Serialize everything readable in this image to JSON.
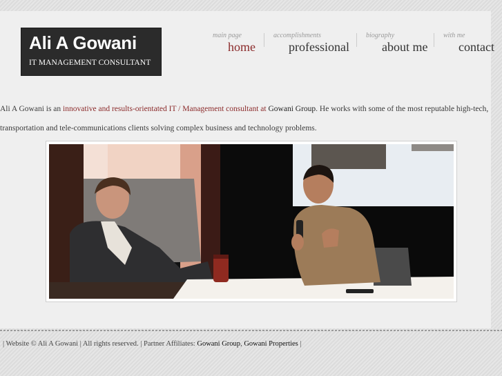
{
  "brand": {
    "name": "Ali A Gowani",
    "tagline": "IT MANAGEMENT CONSULTANT"
  },
  "nav": {
    "items": [
      {
        "sub": "main page",
        "label": "home",
        "active": true
      },
      {
        "sub": "accomplishments",
        "label": "professional",
        "active": false
      },
      {
        "sub": "biography",
        "label": "about me",
        "active": false
      },
      {
        "sub": "with me",
        "label": "contact",
        "active": false
      }
    ]
  },
  "intro": {
    "lead": "Ali A Gowani is an ",
    "highlight": "innovative and results-orientated IT / Management consultant at",
    "space": " ",
    "company": "Gowani Group",
    "rest": ". He works with some of the most reputable high-tech, transportation and tele-communications clients solving complex business and technology problems."
  },
  "hero": {
    "image": "photo of two men seated on a conference stage, one holding a microphone"
  },
  "footer": {
    "copyright": "| Website © Ali A Gowani | All rights reserved. | Partner Affiliates: ",
    "affiliate1": "Gowani Group",
    "comma": ", ",
    "affiliate2": "Gowani Properties",
    "end": " |"
  },
  "colors": {
    "accent": "#8b2a2a",
    "logo_bg": "#2b2b2b",
    "text": "#3a3a3a",
    "page_bg": "#efefef"
  }
}
